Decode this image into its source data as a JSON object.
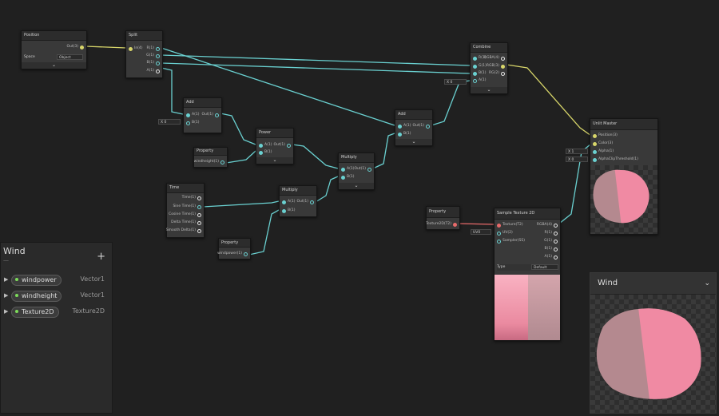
{
  "nodes": {
    "position": {
      "title": "Position",
      "out": "Out(3)",
      "space_label": "Space",
      "space_value": "Object"
    },
    "split": {
      "title": "Split",
      "in": "In(4)",
      "r": "R(1)",
      "g": "G(1)",
      "b": "B(1)",
      "a": "A(1)"
    },
    "add1": {
      "title": "Add",
      "a": "A(1)",
      "b": "B(1)",
      "out": "Out(1)",
      "b_default": "X 0"
    },
    "property_windheight": {
      "title": "Property",
      "out": "windheight(1)"
    },
    "power": {
      "title": "Power",
      "a": "A(1)",
      "b": "B(1)",
      "out": "Out(1)"
    },
    "time": {
      "title": "Time",
      "outputs": [
        "Time(1)",
        "Sine Time(1)",
        "Cosine Time(1)",
        "Delta Time(1)",
        "Smooth Delta(1)"
      ]
    },
    "multiply2": {
      "title": "Multiply",
      "a": "A(1)",
      "b": "B(1)",
      "out": "Out(1)"
    },
    "property_windpower": {
      "title": "Property",
      "out": "windpower(1)"
    },
    "multiply1": {
      "title": "Multiply",
      "a": "A(1)",
      "b": "B(1)",
      "out": "Out(1)"
    },
    "add2": {
      "title": "Add",
      "a": "A(1)",
      "b": "B(1)",
      "out": "Out(1)"
    },
    "combine": {
      "title": "Combine",
      "inputs": [
        "R(1)",
        "G(1)",
        "B(1)",
        "A(1)"
      ],
      "outputs": [
        "RGBA(4)",
        "RGB(3)",
        "RG(2)"
      ],
      "a_default": "X 0"
    },
    "unlit_master": {
      "title": "Unlit Master",
      "inputs": [
        "Position(3)",
        "Color(3)",
        "Alpha(1)",
        "AlphaClipThreshold(1)"
      ],
      "alpha_default": "X 1",
      "clip_default": "X 0"
    },
    "property_texture": {
      "title": "Property",
      "out": "Texture2D(T2)"
    },
    "sample_texture": {
      "title": "Sample Texture 2D",
      "inputs": [
        "Texture(T2)",
        "UV(2)",
        "Sampler(SS)"
      ],
      "outputs": [
        "RGBA(4)",
        "R(1)",
        "G(1)",
        "B(1)",
        "A(1)"
      ],
      "uv_default": "UV0",
      "type_label": "Type",
      "type_value": "Default"
    }
  },
  "blackboard": {
    "title": "Wind",
    "subtitle": "—",
    "add_label": "+",
    "properties": [
      {
        "name": "windpower",
        "type": "Vector1"
      },
      {
        "name": "windheight",
        "type": "Vector1"
      },
      {
        "name": "Texture2D",
        "type": "Texture2D"
      }
    ]
  },
  "main_preview": {
    "title": "Wind"
  },
  "colors": {
    "wire_float": "#6ad1d1",
    "wire_vector3": "#d8d66a",
    "wire_texture": "#e86a6a",
    "preview_pink": "#f08aa3",
    "preview_mauve": "#b4898f"
  }
}
